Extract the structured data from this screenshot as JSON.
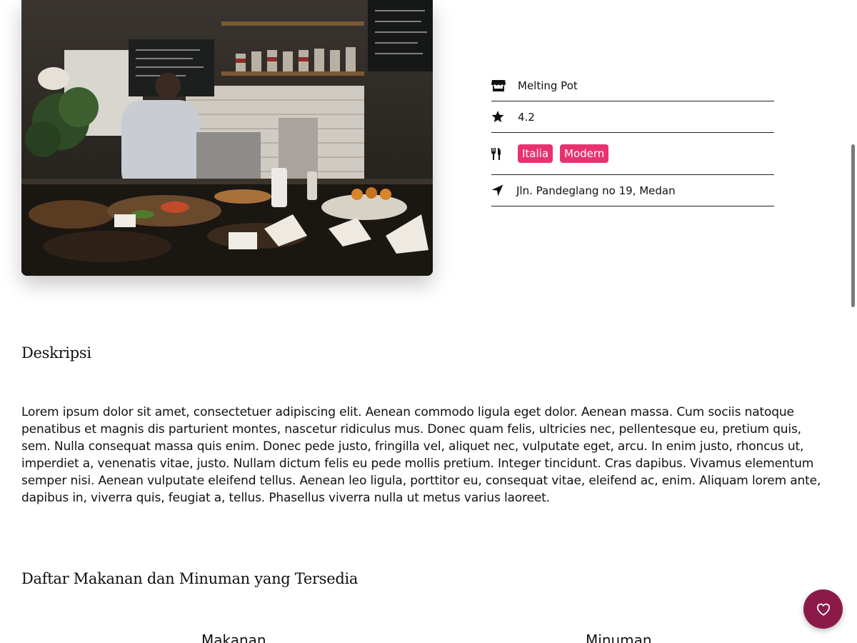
{
  "restaurant": {
    "name": "Melting Pot",
    "rating": "4.2",
    "categories": [
      "Italia",
      "Modern"
    ],
    "address": "Jln. Pandeglang no 19, Medan"
  },
  "sections": {
    "description_title": "Deskripsi",
    "description_text": "Lorem ipsum dolor sit amet, consectetuer adipiscing elit. Aenean commodo ligula eget dolor. Aenean massa. Cum sociis natoque penatibus et magnis dis parturient montes, nascetur ridiculus mus. Donec quam felis, ultricies nec, pellentesque eu, pretium quis, sem. Nulla consequat massa quis enim. Donec pede justo, fringilla vel, aliquet nec, vulputate eget, arcu. In enim justo, rhoncus ut, imperdiet a, venenatis vitae, justo. Nullam dictum felis eu pede mollis pretium. Integer tincidunt. Cras dapibus. Vivamus elementum semper nisi. Aenean vulputate eleifend tellus. Aenean leo ligula, porttitor eu, consequat vitae, eleifend ac, enim. Aliquam lorem ante, dapibus in, viverra quis, feugiat a, tellus. Phasellus viverra nulla ut metus varius laoreet.",
    "menu_title": "Daftar Makanan dan Minuman yang Tersedia",
    "food_heading": "Makanan",
    "drink_heading": "Minuman"
  },
  "icons": {
    "name": "store-icon",
    "rating": "star-icon",
    "category": "utensils-icon",
    "address": "location-arrow-icon",
    "favorite": "heart-outline-icon"
  },
  "colors": {
    "tag_background": "#e8326f",
    "fab_background": "#8c1a49"
  }
}
